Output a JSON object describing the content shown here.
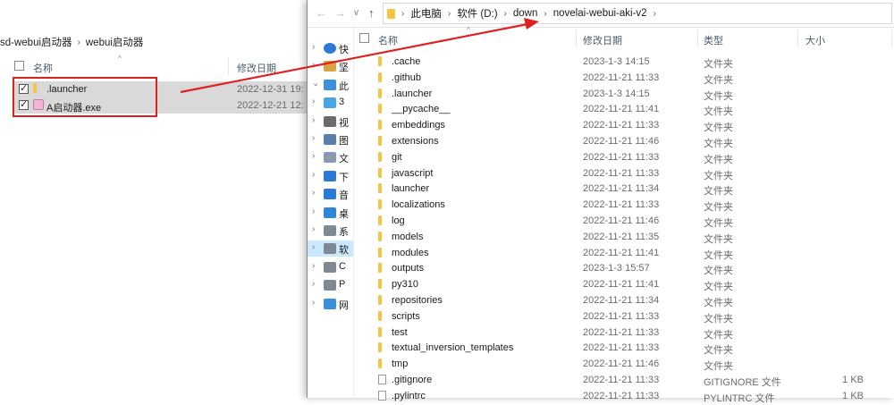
{
  "left_window": {
    "breadcrumb": [
      "sd-webui启动器",
      "webui启动器"
    ],
    "header": {
      "name": "名称",
      "date": "修改日期"
    },
    "files": [
      {
        "name": ".launcher",
        "date": "2022-12-31 19:",
        "icon": "folder-icon",
        "checked": true
      },
      {
        "name": "A启动器.exe",
        "date": "2022-12-21 12:",
        "icon": "exe-icon",
        "checked": true
      }
    ]
  },
  "right_window": {
    "address": [
      "此电脑",
      "软件 (D:)",
      "down",
      "novelai-webui-aki-v2"
    ],
    "nav": [
      {
        "label": "快",
        "icon": "star-icon",
        "expanded": false
      },
      {
        "label": "坚",
        "icon": "cloud-icon",
        "expanded": false
      },
      {
        "label": "此",
        "icon": "computer-icon",
        "expanded": true
      },
      {
        "label": "3",
        "icon": "cube-icon",
        "expanded": false
      },
      {
        "label": "视",
        "icon": "video-icon",
        "expanded": false
      },
      {
        "label": "图",
        "icon": "picture-icon",
        "expanded": false
      },
      {
        "label": "文",
        "icon": "document-icon",
        "expanded": false
      },
      {
        "label": "下",
        "icon": "download-icon",
        "expanded": false
      },
      {
        "label": "音",
        "icon": "music-icon",
        "expanded": false
      },
      {
        "label": "桌",
        "icon": "desktop-icon",
        "expanded": false
      },
      {
        "label": "系",
        "icon": "drive-icon",
        "expanded": false
      },
      {
        "label": "软",
        "icon": "drive-icon",
        "expanded": false,
        "selected": true
      },
      {
        "label": "C",
        "icon": "drive-icon",
        "expanded": false
      },
      {
        "label": "P",
        "icon": "drive-icon",
        "expanded": false
      },
      {
        "label": "网",
        "icon": "network-icon",
        "expanded": false
      }
    ],
    "header": {
      "name": "名称",
      "date": "修改日期",
      "type": "类型",
      "size": "大小"
    },
    "files": [
      {
        "name": ".cache",
        "date": "2023-1-3 14:15",
        "type": "文件夹",
        "size": "",
        "kind": "folder"
      },
      {
        "name": ".github",
        "date": "2022-11-21 11:33",
        "type": "文件夹",
        "size": "",
        "kind": "folder"
      },
      {
        "name": ".launcher",
        "date": "2023-1-3 14:15",
        "type": "文件夹",
        "size": "",
        "kind": "folder"
      },
      {
        "name": "__pycache__",
        "date": "2022-11-21 11:41",
        "type": "文件夹",
        "size": "",
        "kind": "folder"
      },
      {
        "name": "embeddings",
        "date": "2022-11-21 11:33",
        "type": "文件夹",
        "size": "",
        "kind": "folder"
      },
      {
        "name": "extensions",
        "date": "2022-11-21 11:46",
        "type": "文件夹",
        "size": "",
        "kind": "folder"
      },
      {
        "name": "git",
        "date": "2022-11-21 11:33",
        "type": "文件夹",
        "size": "",
        "kind": "folder"
      },
      {
        "name": "javascript",
        "date": "2022-11-21 11:33",
        "type": "文件夹",
        "size": "",
        "kind": "folder"
      },
      {
        "name": "launcher",
        "date": "2022-11-21 11:34",
        "type": "文件夹",
        "size": "",
        "kind": "folder"
      },
      {
        "name": "localizations",
        "date": "2022-11-21 11:33",
        "type": "文件夹",
        "size": "",
        "kind": "folder"
      },
      {
        "name": "log",
        "date": "2022-11-21 11:46",
        "type": "文件夹",
        "size": "",
        "kind": "folder"
      },
      {
        "name": "models",
        "date": "2022-11-21 11:35",
        "type": "文件夹",
        "size": "",
        "kind": "folder"
      },
      {
        "name": "modules",
        "date": "2022-11-21 11:41",
        "type": "文件夹",
        "size": "",
        "kind": "folder"
      },
      {
        "name": "outputs",
        "date": "2023-1-3 15:57",
        "type": "文件夹",
        "size": "",
        "kind": "folder"
      },
      {
        "name": "py310",
        "date": "2022-11-21 11:41",
        "type": "文件夹",
        "size": "",
        "kind": "folder"
      },
      {
        "name": "repositories",
        "date": "2022-11-21 11:34",
        "type": "文件夹",
        "size": "",
        "kind": "folder"
      },
      {
        "name": "scripts",
        "date": "2022-11-21 11:33",
        "type": "文件夹",
        "size": "",
        "kind": "folder"
      },
      {
        "name": "test",
        "date": "2022-11-21 11:33",
        "type": "文件夹",
        "size": "",
        "kind": "folder"
      },
      {
        "name": "textual_inversion_templates",
        "date": "2022-11-21 11:33",
        "type": "文件夹",
        "size": "",
        "kind": "folder"
      },
      {
        "name": "tmp",
        "date": "2022-11-21 11:46",
        "type": "文件夹",
        "size": "",
        "kind": "folder"
      },
      {
        "name": ".gitignore",
        "date": "2022-11-21 11:33",
        "type": "GITIGNORE 文件",
        "size": "1 KB",
        "kind": "file"
      },
      {
        "name": ".pylintrc",
        "date": "2022-11-21 11:33",
        "type": "PYLINTRC 文件",
        "size": "1 KB",
        "kind": "file"
      }
    ]
  },
  "annotation": {
    "color": "#e02020"
  }
}
